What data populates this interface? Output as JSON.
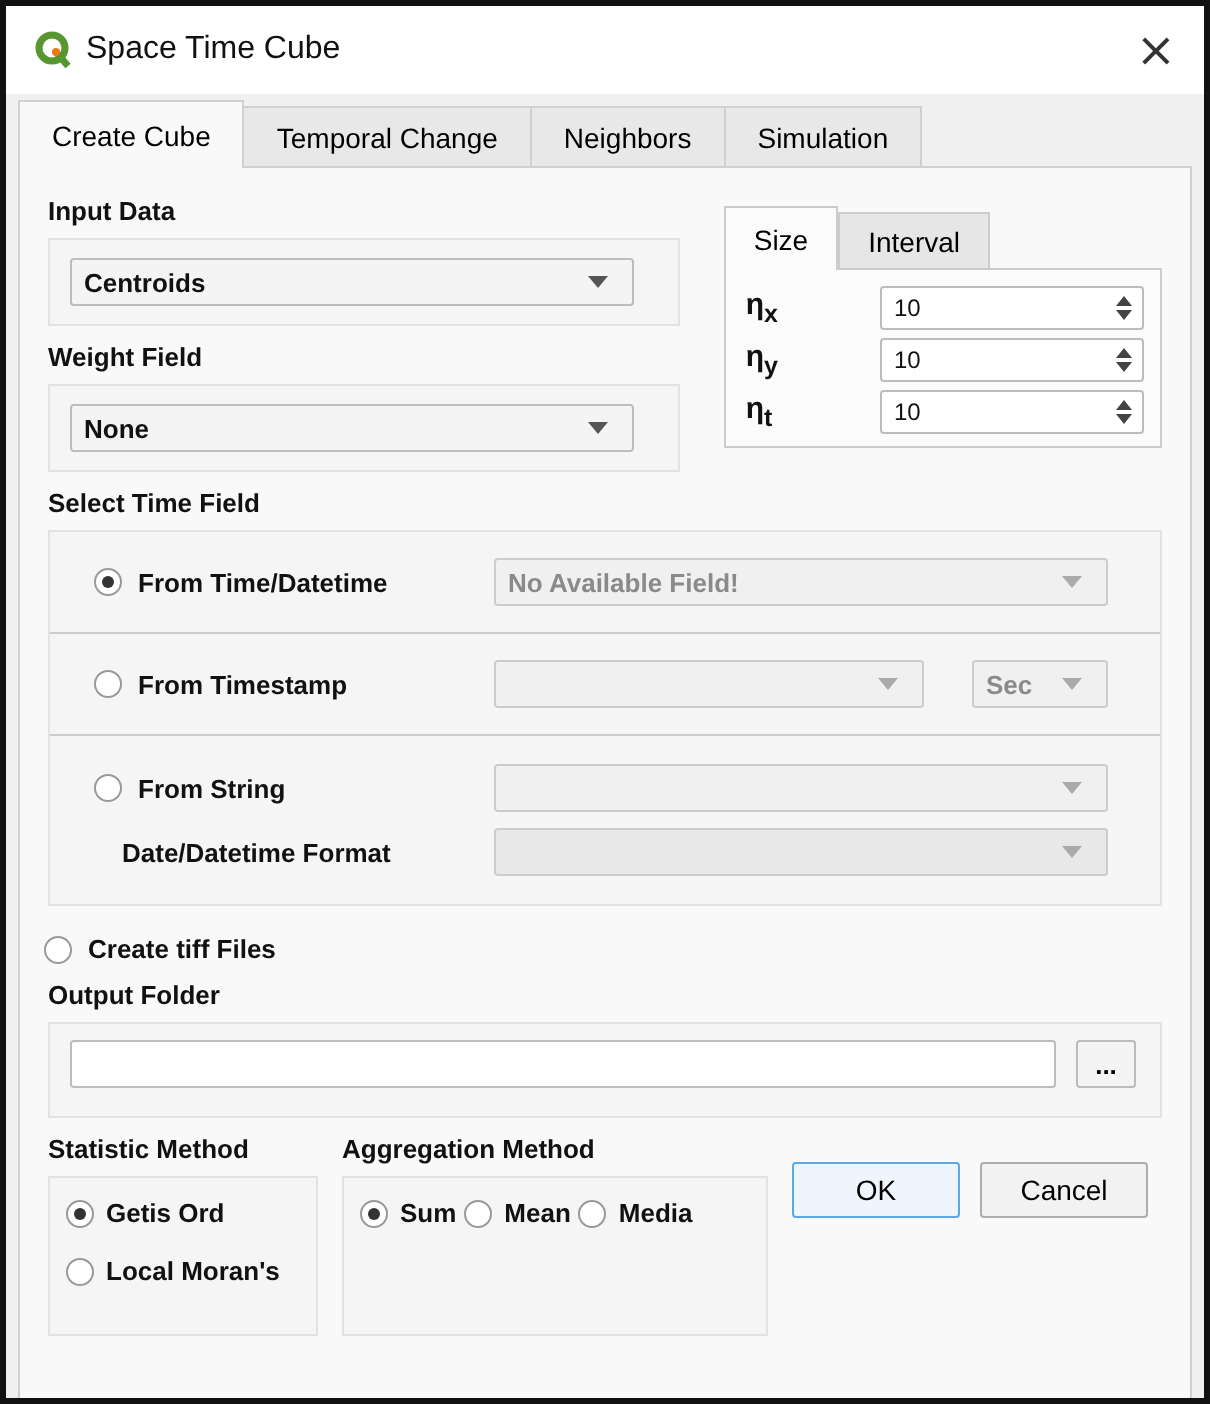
{
  "window": {
    "title": "Space Time Cube",
    "close": "×"
  },
  "tabs": [
    {
      "label": "Create Cube",
      "selected": true
    },
    {
      "label": "Temporal Change",
      "selected": false
    },
    {
      "label": "Neighbors",
      "selected": false
    },
    {
      "label": "Simulation",
      "selected": false
    }
  ],
  "input_data": {
    "label": "Input Data",
    "value": "Centroids"
  },
  "weight_field": {
    "label": "Weight Field",
    "value": "None"
  },
  "size_panel": {
    "tabs": [
      {
        "label": "Size",
        "selected": true
      },
      {
        "label": "Interval",
        "selected": false
      }
    ],
    "spinners": [
      {
        "symbol": "η$_{x}$",
        "value": "10"
      },
      {
        "symbol": "η$_{y}$",
        "value": "10"
      },
      {
        "symbol": "η$_{t}$",
        "value": "10"
      }
    ]
  },
  "time_field": {
    "label": "Select Time Field",
    "options": [
      {
        "kind": "datetime",
        "label": "From Time/Datetime",
        "selected": true,
        "field": "No Available Field!"
      },
      {
        "kind": "timestamp",
        "label": "From Timestamp",
        "selected": false,
        "unit": "Sec"
      },
      {
        "kind": "string",
        "label": "From String",
        "selected": false,
        "format_label": "Date/Datetime Format"
      }
    ]
  },
  "create_tiff": {
    "label": "Create tiff Files",
    "checked": false
  },
  "output_folder": {
    "label": "Output Folder",
    "browse": "..."
  },
  "statistic_method": {
    "label": "Statistic Method",
    "options": [
      {
        "label": "Getis Ord",
        "selected": true
      },
      {
        "label": "Local Moran's",
        "selected": false
      }
    ]
  },
  "aggregation_method": {
    "label": "Aggregation Method",
    "options": [
      {
        "label": "Sum",
        "selected": true
      },
      {
        "label": "Mean",
        "selected": false
      },
      {
        "label": "Media",
        "selected": false
      }
    ]
  },
  "buttons": [
    {
      "label": "OK",
      "default": true
    },
    {
      "label": "Cancel",
      "default": false
    }
  ]
}
